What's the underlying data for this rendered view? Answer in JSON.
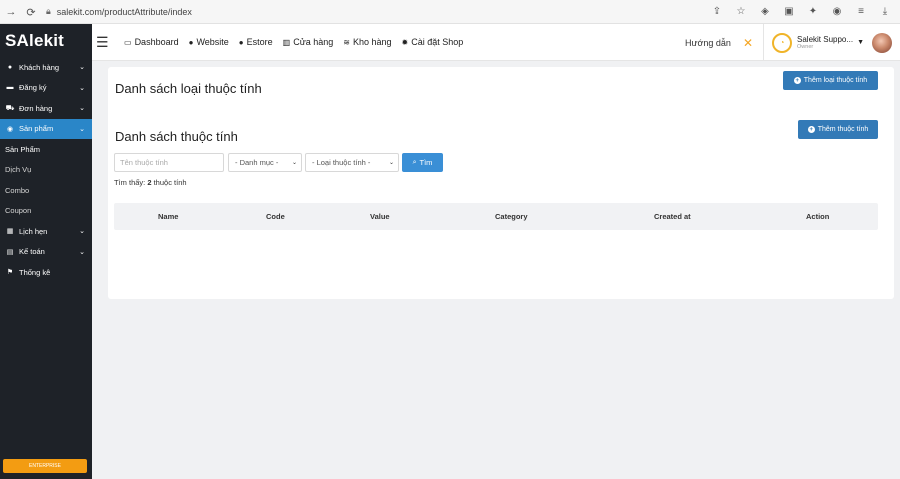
{
  "browser": {
    "url": "salekit.com/productAttribute/index",
    "icons": [
      "back-icon",
      "reload-icon",
      "lock-icon",
      "share-icon",
      "star-icon",
      "shield-icon",
      "download-ext-icon",
      "puzzle-icon",
      "profile-icon",
      "menu-icon",
      "download-icon"
    ]
  },
  "sidebar": {
    "logo": "SAlekit",
    "items": [
      {
        "label": "Khách hàng",
        "icon": "user-icon",
        "has_chevron": true
      },
      {
        "label": "Đăng ký",
        "icon": "card-icon",
        "has_chevron": true
      },
      {
        "label": "Đơn hàng",
        "icon": "cart-icon",
        "has_chevron": true
      },
      {
        "label": "Sản phẩm",
        "icon": "product-icon",
        "has_chevron": true,
        "active": true
      }
    ],
    "subitems": [
      {
        "label": "Sản Phẩm",
        "current": true
      },
      {
        "label": "Dịch Vụ"
      },
      {
        "label": "Combo"
      },
      {
        "label": "Coupon"
      }
    ],
    "items2": [
      {
        "label": "Lịch hẹn",
        "icon": "calendar-icon",
        "has_chevron": true
      },
      {
        "label": "Kế toán",
        "icon": "ledger-icon",
        "has_chevron": true
      },
      {
        "label": "Thống kê",
        "icon": "flag-icon",
        "has_chevron": false
      }
    ],
    "bottom_button": "ENTERPRISE",
    "accent": "#2a86c8"
  },
  "topnav": {
    "items": [
      {
        "label": "Dashboard",
        "icon": "monitor-icon"
      },
      {
        "label": "Website",
        "icon": "globe-icon"
      },
      {
        "label": "Estore",
        "icon": "globe-icon"
      },
      {
        "label": "Cửa hàng",
        "icon": "store-icon"
      },
      {
        "label": "Kho hàng",
        "icon": "database-icon"
      },
      {
        "label": "Cài đặt Shop",
        "icon": "gear-icon"
      }
    ],
    "guide": "Hướng dẫn",
    "user_name": "Salekit Suppo...",
    "user_role": "Owner"
  },
  "main": {
    "type_title": "Danh sách loại thuộc tính",
    "add_type_button": "Thêm loại thuộc tính",
    "attr_title": "Danh sách thuộc tính",
    "add_attr_button": "Thêm thuộc tính",
    "search_placeholder": "Tên thuộc tính",
    "category_select": "- Danh mục -",
    "type_select": "- Loại thuộc tính -",
    "search_button": "Tìm",
    "found_prefix": "Tìm thấy: ",
    "found_count": "2",
    "found_suffix": " thuộc tính",
    "table_headers": [
      "Name",
      "Code",
      "Value",
      "Category",
      "Created at",
      "Action"
    ],
    "primary_color": "#337ab7"
  }
}
